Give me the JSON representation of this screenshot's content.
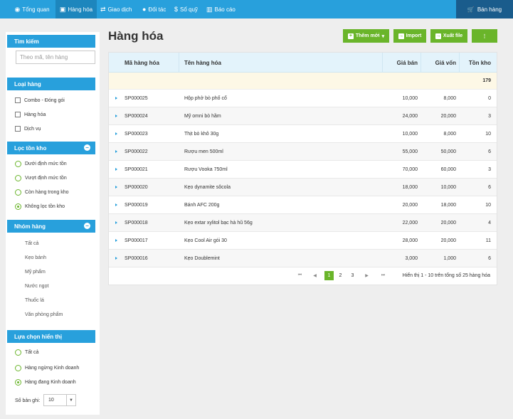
{
  "nav": {
    "items": [
      {
        "label": "Tổng quan",
        "icon": "eye-icon"
      },
      {
        "label": "Hàng hóa",
        "icon": "box-icon"
      },
      {
        "label": "Giao dịch",
        "icon": "transfer-icon"
      },
      {
        "label": "Đối tác",
        "icon": "user-icon"
      },
      {
        "label": "Sổ quỹ",
        "icon": "dollar-icon"
      },
      {
        "label": "Báo cáo",
        "icon": "chart-icon"
      }
    ],
    "sell_label": "Bán hàng"
  },
  "sidebar": {
    "search": {
      "title": "Tìm kiếm",
      "placeholder": "Theo mã, tên hàng"
    },
    "type": {
      "title": "Loại hàng",
      "options": [
        "Combo - Đóng gói",
        "Hàng hóa",
        "Dịch vụ"
      ]
    },
    "stock": {
      "title": "Lọc tồn kho",
      "options": [
        "Dưới định mức tồn",
        "Vượt định mức tồn",
        "Còn hàng trong kho",
        "Không lọc tồn kho"
      ],
      "selected": 3
    },
    "group": {
      "title": "Nhóm hàng",
      "items": [
        "Tất cả",
        "Kẹo bánh",
        "Mỹ phẩm",
        "Nước ngọt",
        "Thuốc lá",
        "Văn phòng phẩm"
      ]
    },
    "display": {
      "title": "Lựa chọn hiển thị",
      "options": [
        "Tất cả",
        "Hàng ngừng Kinh doanh",
        "Hàng đang Kinh doanh"
      ],
      "selected": 2
    },
    "records": {
      "label": "Số bản ghi:",
      "value": "10"
    }
  },
  "main": {
    "title": "Hàng hóa",
    "buttons": {
      "add": "Thêm mới",
      "import": "Import",
      "export": "Xuất file"
    },
    "columns": [
      "Mã hàng hóa",
      "Tên hàng hóa",
      "Giá bán",
      "Giá vốn",
      "Tồn kho"
    ],
    "total_stock": "179",
    "rows": [
      {
        "code": "SP000025",
        "name": "Hộp phở bò phố cổ",
        "price": "10,000",
        "cost": "8,000",
        "stock": "0"
      },
      {
        "code": "SP000024",
        "name": "Mỹ omni bò hầm",
        "price": "24,000",
        "cost": "20,000",
        "stock": "3"
      },
      {
        "code": "SP000023",
        "name": "Thịt bò khô 30g",
        "price": "10,000",
        "cost": "8,000",
        "stock": "10"
      },
      {
        "code": "SP000022",
        "name": "Rượu men 500ml",
        "price": "55,000",
        "cost": "50,000",
        "stock": "6"
      },
      {
        "code": "SP000021",
        "name": "Rượu Vooka 750ml",
        "price": "70,000",
        "cost": "60,000",
        "stock": "3"
      },
      {
        "code": "SP000020",
        "name": "Kẹo dynamite sôcola",
        "price": "18,000",
        "cost": "10,000",
        "stock": "6"
      },
      {
        "code": "SP000019",
        "name": "Bánh AFC 200g",
        "price": "20,000",
        "cost": "18,000",
        "stock": "10"
      },
      {
        "code": "SP000018",
        "name": "Kẹo extar xylitol bạc hà hũ 56g",
        "price": "22,000",
        "cost": "20,000",
        "stock": "4"
      },
      {
        "code": "SP000017",
        "name": "Kẹo Cool Air gói 30",
        "price": "28,000",
        "cost": "20,000",
        "stock": "11"
      },
      {
        "code": "SP000016",
        "name": "Kẹo Doublemint",
        "price": "3,000",
        "cost": "1,000",
        "stock": "6"
      }
    ],
    "pagination": {
      "pages": [
        "1",
        "2",
        "3"
      ],
      "current": "1",
      "first": "⏮",
      "prev": "◀",
      "next": "▶",
      "last": "⏭",
      "info": "Hiển thị 1 - 10 trên tổng số 25 hàng hóa"
    }
  }
}
